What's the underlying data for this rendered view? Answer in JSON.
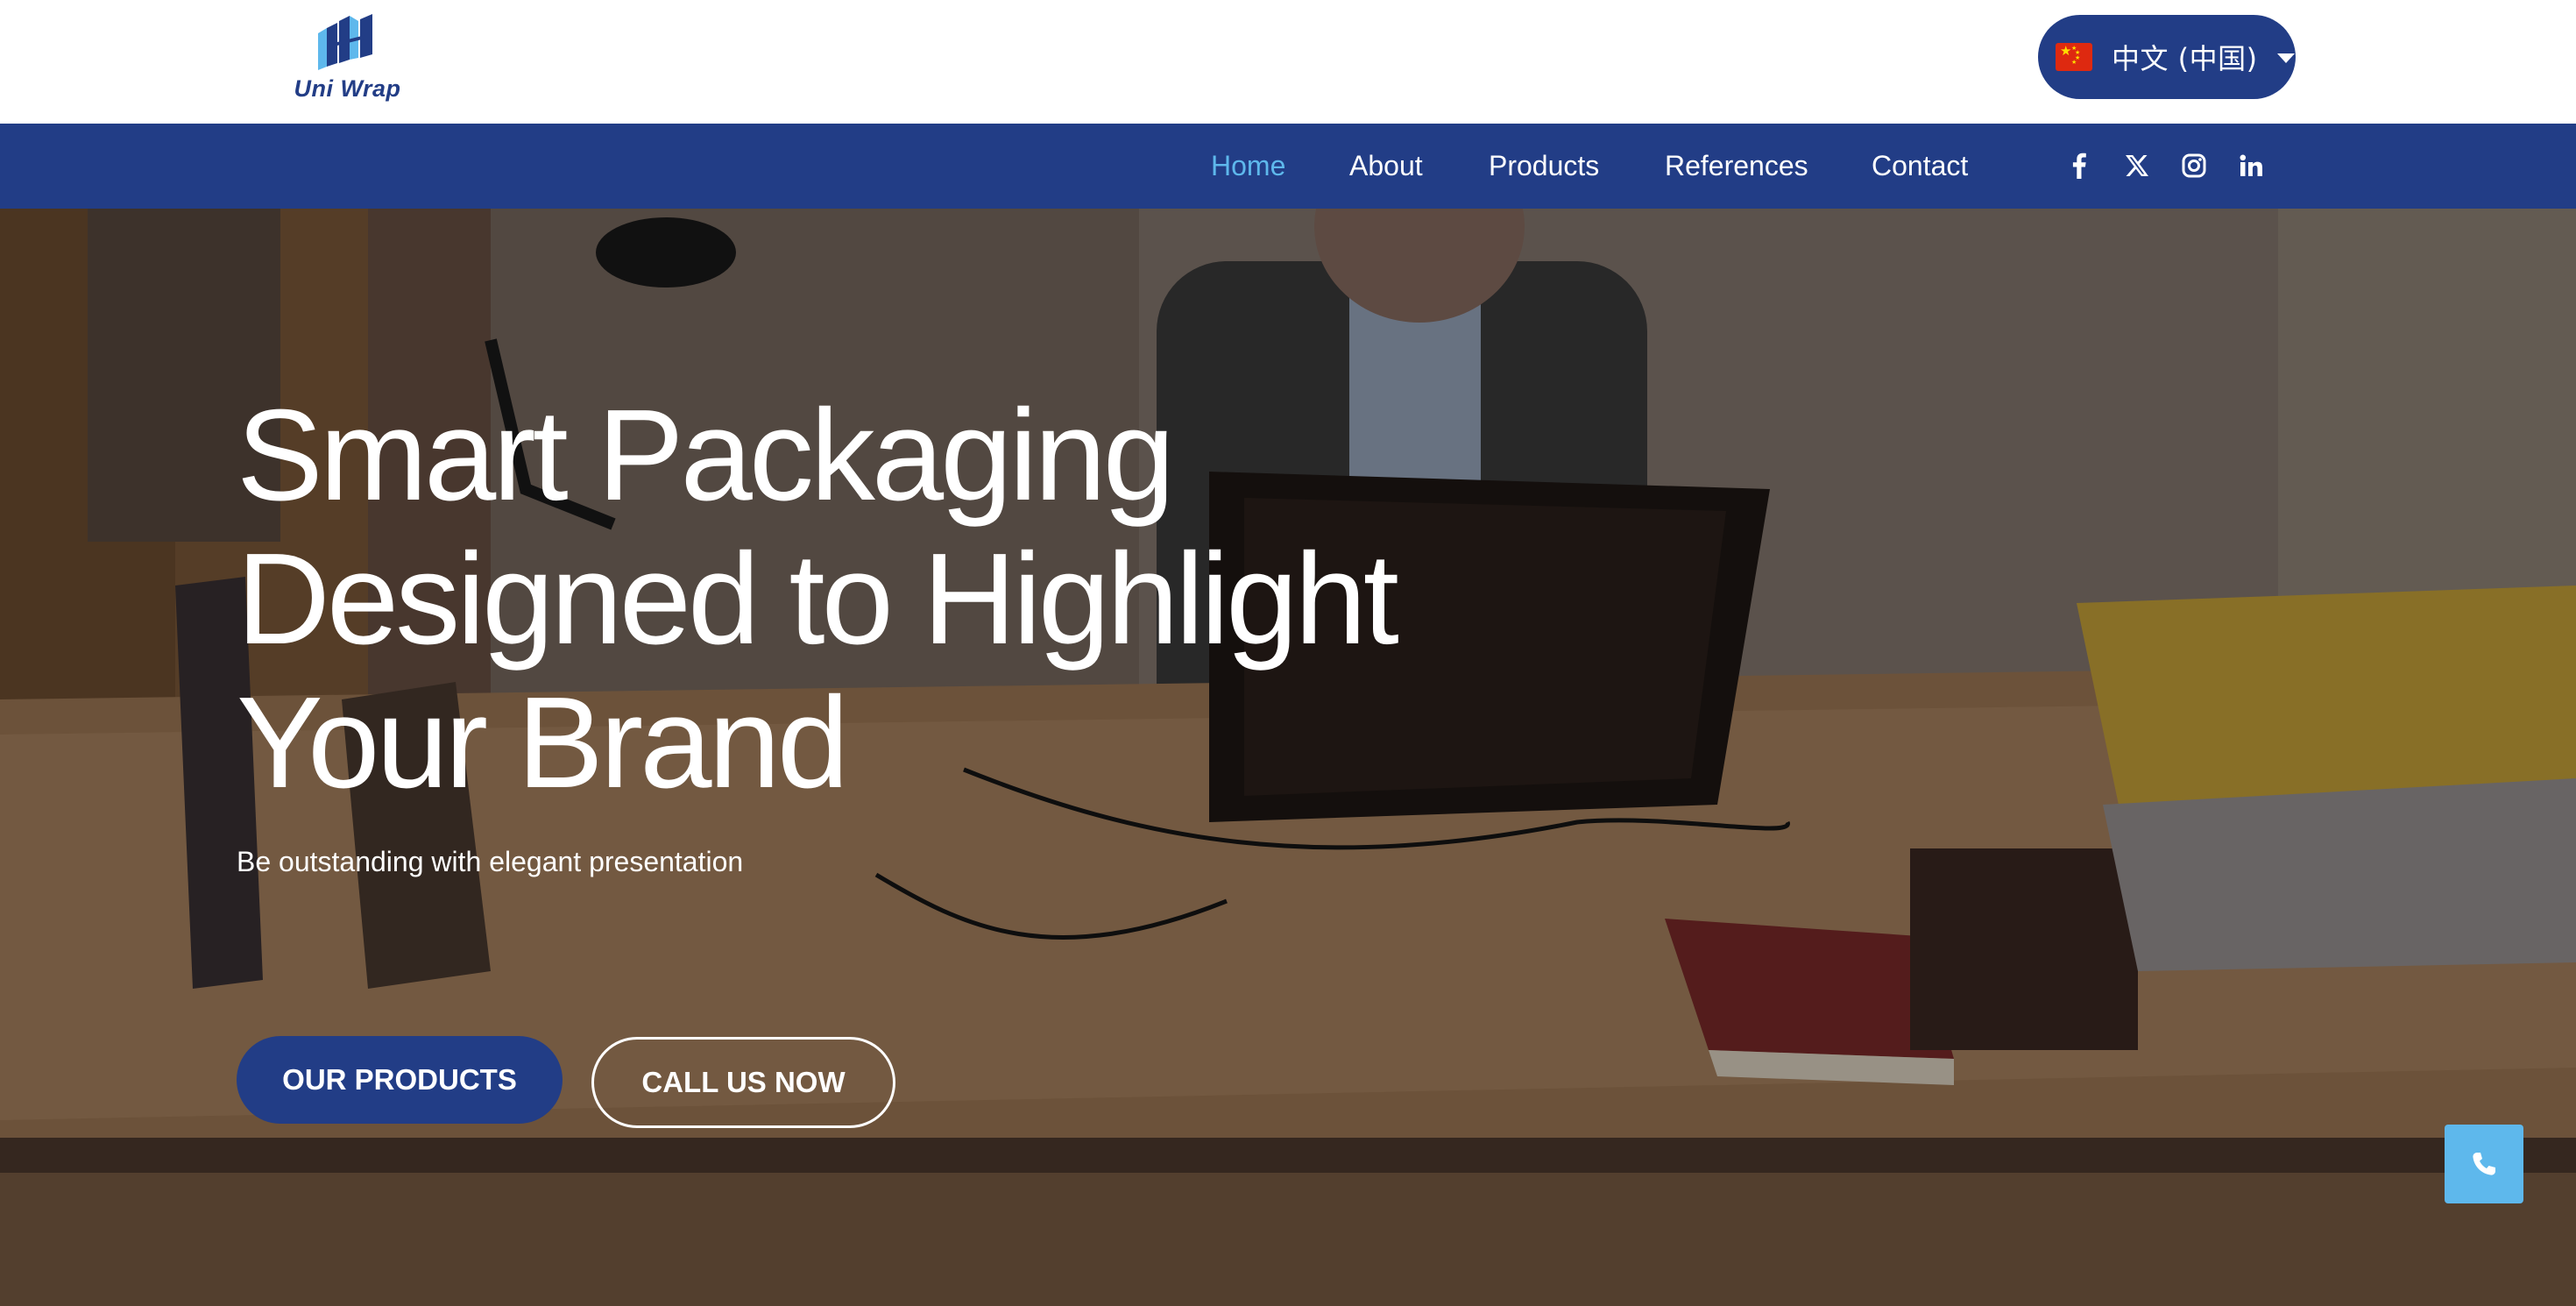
{
  "header": {
    "logo_text": "Uni Wrap",
    "language": {
      "flag": "china-flag-icon",
      "label": "中文 (中国)"
    }
  },
  "nav": {
    "items": [
      {
        "label": "Home",
        "active": true
      },
      {
        "label": "About",
        "active": false
      },
      {
        "label": "Products",
        "active": false
      },
      {
        "label": "References",
        "active": false
      },
      {
        "label": "Contact",
        "active": false
      }
    ],
    "social": [
      "facebook-icon",
      "x-icon",
      "instagram-icon",
      "linkedin-icon"
    ]
  },
  "hero": {
    "title_lines": [
      "Smart Packaging",
      "Designed to Highlight",
      "Your Brand"
    ],
    "subtitle": "Be outstanding with elegant presentation",
    "primary_button": "OUR PRODUCTS",
    "secondary_button": "CALL US NOW"
  },
  "floating": {
    "icon": "phone-icon"
  },
  "colors": {
    "brand_blue": "#223d86",
    "accent_light_blue": "#5eb8ec",
    "white": "#ffffff"
  }
}
